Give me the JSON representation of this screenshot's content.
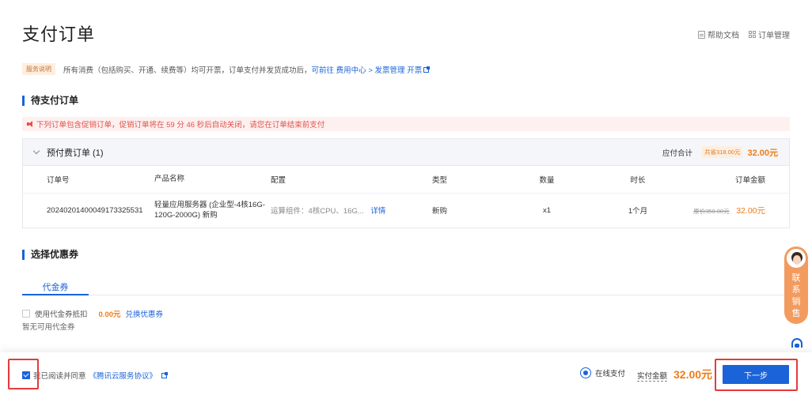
{
  "page": {
    "title": "支付订单"
  },
  "top_links": {
    "help": "帮助文档",
    "orders": "订单管理"
  },
  "notice": {
    "badge": "服务说明",
    "text": "所有消费（包括购买、开通、续费等）均可开票，订单支付并发货成功后，",
    "link_prefix": "可前往",
    "link_cost": "费用中心",
    "sep": ">",
    "link_invoice": "发票管理",
    "link_open": "开票"
  },
  "pending": {
    "section_title": "待支付订单",
    "promo_notice": "下列订单包含促销订单，促销订单将在 59 分 46 秒后自动关闭，请您在订单结束前支付",
    "group_label": "预付费订单 (1)",
    "total_label": "应付合计",
    "saved": "共省318.00元",
    "total_value": "32.00元",
    "columns": [
      "订单号",
      "产品名称",
      "配置",
      "类型",
      "数量",
      "时长",
      "订单金额"
    ],
    "rows": [
      {
        "id": "20240201400049173325531",
        "product": "轻量应用服务器 (企业型-4核16G-120G-2000G) 新购",
        "config": "运算组件：4核CPU、16G...",
        "config_link": "详情",
        "type": "新购",
        "qty": "x1",
        "duration": "1个月",
        "original_price": "原价350.00元",
        "amount": "32.00元"
      }
    ]
  },
  "coupon": {
    "section_title": "选择优惠券",
    "tab": "代金券",
    "use_label": "使用代金券抵扣",
    "use_amount": "0.00元",
    "exchange_link": "兑换优惠券",
    "none_text": "暂无可用代金券"
  },
  "float": {
    "sales_text": "联系销售"
  },
  "footer": {
    "agree_text": "我已阅读并同意",
    "agree_link": "《腾讯云服务协议》",
    "pay_method": "在线支付",
    "pay_label": "实付金额",
    "pay_amount": "32.00元",
    "next_button": "下一步"
  },
  "colors": {
    "primary": "#1a63d9",
    "accent": "#f07c16",
    "highlight": "#e53a3a"
  }
}
